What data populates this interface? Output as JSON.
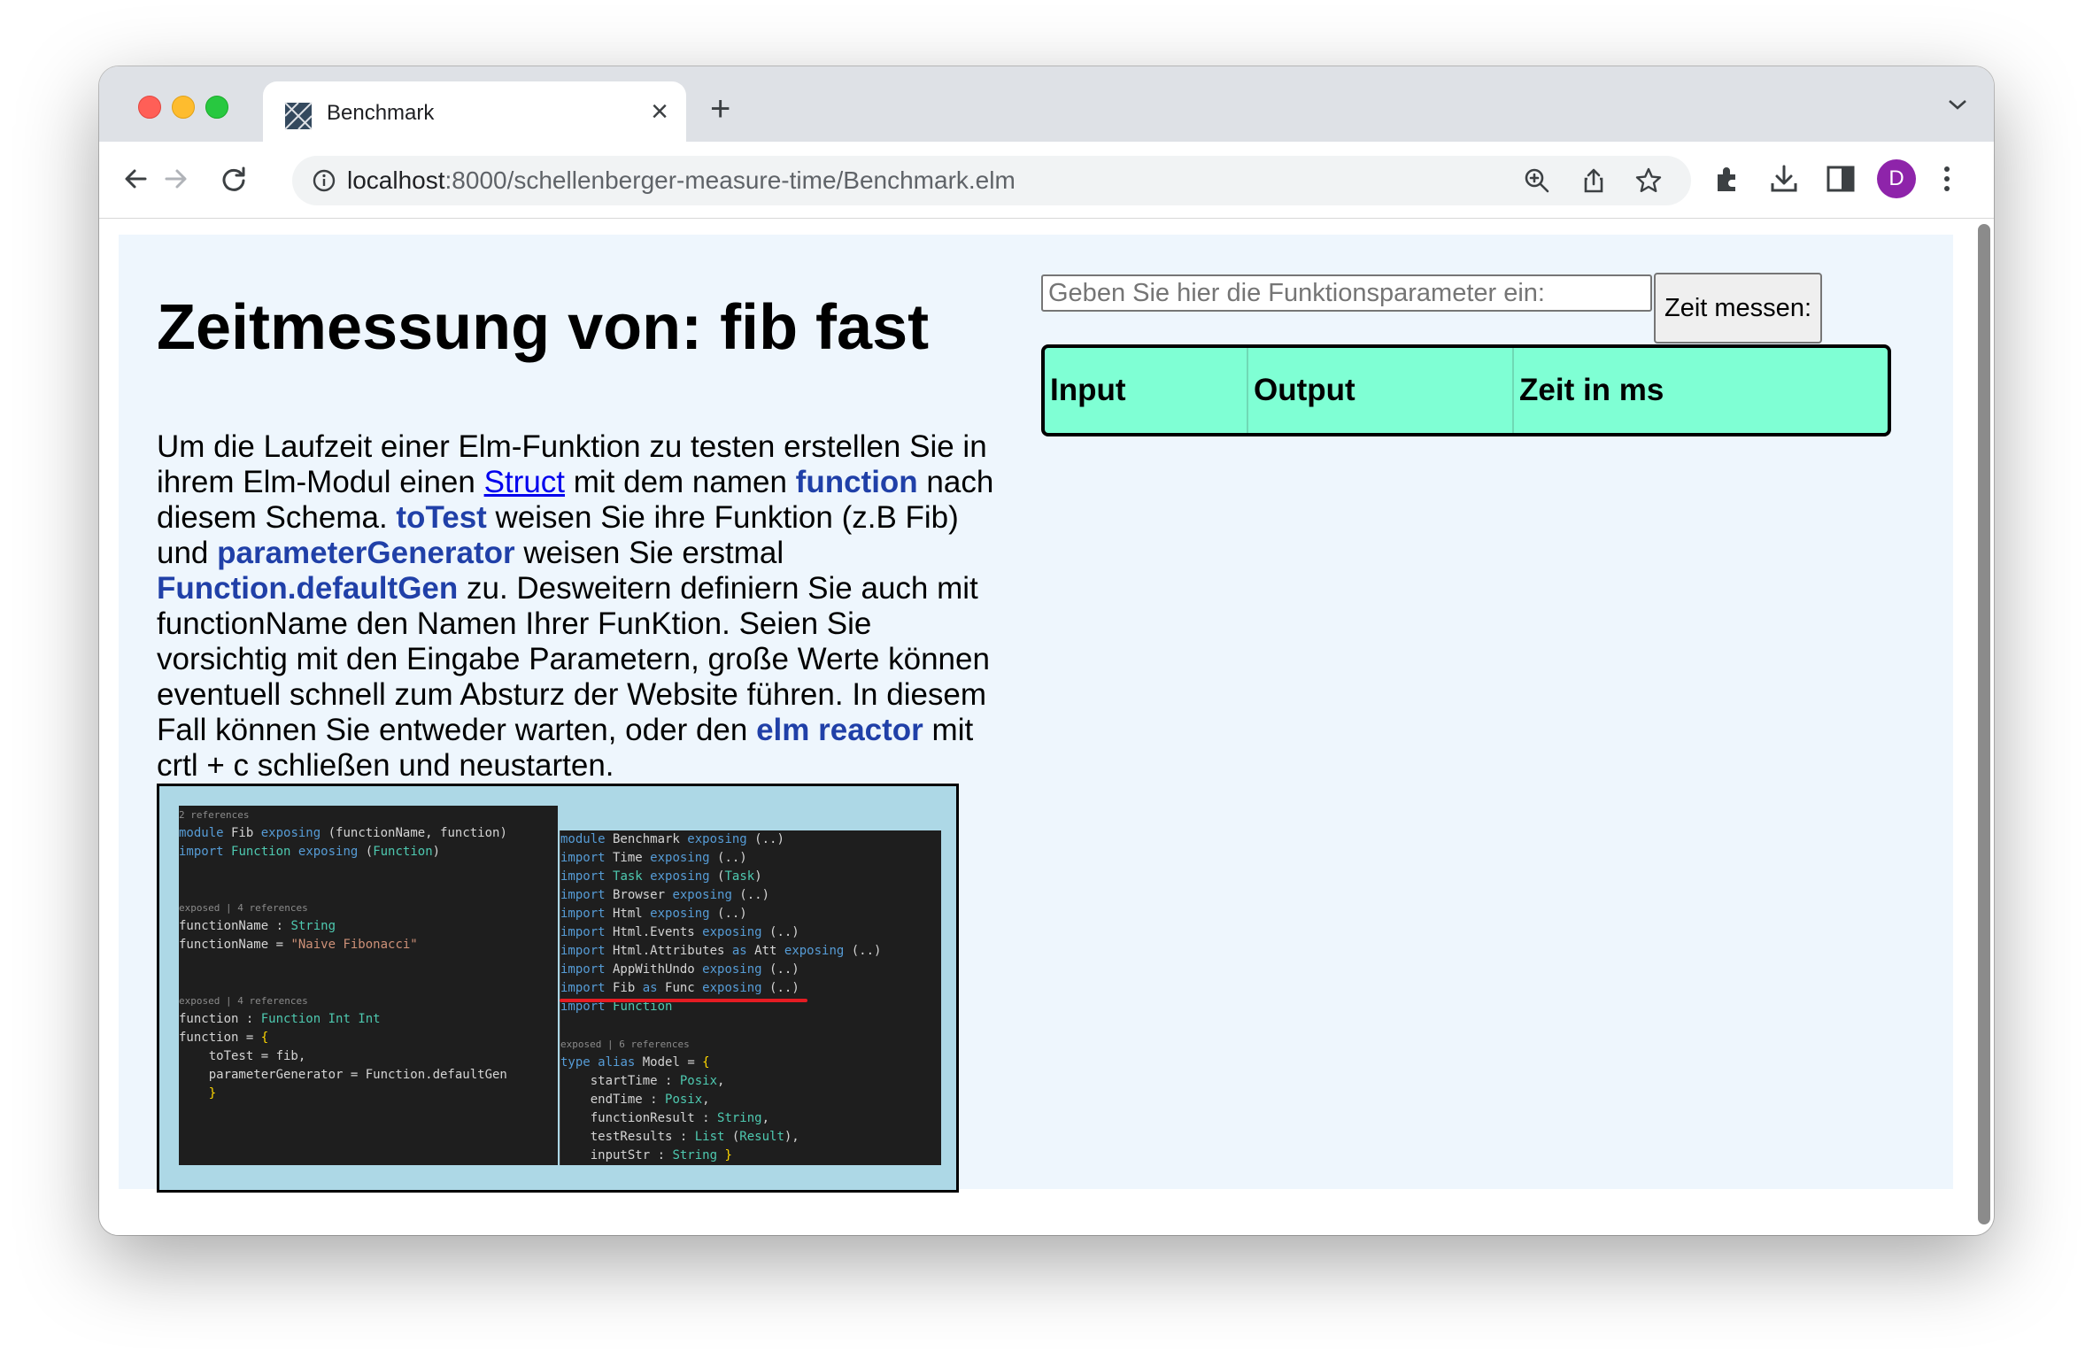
{
  "browser": {
    "tab_title": "Benchmark",
    "url_host": "localhost",
    "url_path": ":8000/schellenberger-measure-time/Benchmark.elm",
    "profile_initial": "D"
  },
  "page": {
    "heading": "Zeitmessung von: fib fast",
    "description": [
      {
        "text": "Um die Laufzeit einer Elm-Funktion zu testen erstellen Sie in ihrem Elm-Modul einen ",
        "style": "plain"
      },
      {
        "text": "Struct",
        "style": "link"
      },
      {
        "text": " mit dem namen ",
        "style": "plain"
      },
      {
        "text": "function",
        "style": "bold"
      },
      {
        "text": " nach diesem Schema. ",
        "style": "plain"
      },
      {
        "text": "toTest",
        "style": "bold"
      },
      {
        "text": " weisen Sie ihre Funktion (z.B Fib) und ",
        "style": "plain"
      },
      {
        "text": "parameterGenerator",
        "style": "bold"
      },
      {
        "text": " weisen Sie erstmal ",
        "style": "plain"
      },
      {
        "text": "Function.defaultGen",
        "style": "bold"
      },
      {
        "text": " zu. Desweitern definiern Sie auch mit functionName den Namen Ihrer FunKtion. Seien Sie vorsichtig mit den Eingabe Parametern, große Werte können eventuell schnell zum Absturz der Website führen. In diesem Fall können Sie entweder warten, oder den ",
        "style": "plain"
      },
      {
        "text": "elm reactor",
        "style": "bold"
      },
      {
        "text": " mit crtl + c schließen und neustarten.",
        "style": "plain"
      }
    ],
    "param_input": {
      "value": "",
      "placeholder": "Geben Sie hier die Funktionsparameter ein:"
    },
    "measure_button": "Zeit messen:",
    "results_table": {
      "headers": [
        "Input",
        "Output",
        "Zeit in ms"
      ],
      "rows": []
    }
  },
  "code_screenshot": {
    "left_pane": [
      {
        "ref": "2 references"
      },
      {
        "code": "module Fib exposing (functionName, function)"
      },
      {
        "code": "import Function exposing (Function)"
      },
      {
        "code": ""
      },
      {
        "code": ""
      },
      {
        "ref": "exposed | 4 references"
      },
      {
        "code": "functionName : String"
      },
      {
        "code": "functionName = \"Naive Fibonacci\""
      },
      {
        "code": ""
      },
      {
        "code": ""
      },
      {
        "ref": "exposed | 4 references"
      },
      {
        "code": "function : Function Int Int"
      },
      {
        "code": "function = {"
      },
      {
        "code": "    toTest = fib,"
      },
      {
        "code": "    parameterGenerator = Function.defaultGen"
      },
      {
        "code": "    }"
      }
    ],
    "right_pane": [
      {
        "code": "module Benchmark exposing (..)"
      },
      {
        "code": "import Time exposing (..)"
      },
      {
        "code": "import Task exposing (Task)"
      },
      {
        "code": "import Browser exposing (..)"
      },
      {
        "code": "import Html exposing (..)"
      },
      {
        "code": "import Html.Events exposing (..)"
      },
      {
        "code": "import Html.Attributes as Att exposing (..)"
      },
      {
        "code": "import AppWithUndo exposing (..)"
      },
      {
        "code": "import Fib as Func exposing (..)"
      },
      {
        "code": "import Function"
      },
      {
        "code": ""
      },
      {
        "ref": "exposed | 6 references"
      },
      {
        "code": "type alias Model = {"
      },
      {
        "code": "    startTime : Posix,"
      },
      {
        "code": "    endTime : Posix,"
      },
      {
        "code": "    functionResult : String,"
      },
      {
        "code": "    testResults : List (Result),"
      },
      {
        "code": "    inputStr : String }"
      }
    ]
  }
}
